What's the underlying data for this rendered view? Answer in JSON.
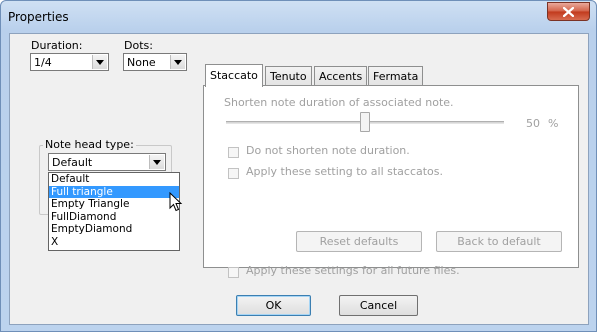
{
  "window": {
    "title": "Properties"
  },
  "duration": {
    "label": "Duration:",
    "value": "1/4"
  },
  "dots": {
    "label": "Dots:",
    "value": "None"
  },
  "notehead": {
    "group_label": "Note head type:",
    "value": "Default",
    "options": [
      "Default",
      "Full triangle",
      "Empty Triangle",
      "FullDiamond",
      "EmptyDiamond",
      "X"
    ],
    "highlighted_index": 1
  },
  "tabs": [
    {
      "label": "Staccato",
      "active": true
    },
    {
      "label": "Tenuto",
      "active": false
    },
    {
      "label": "Accents",
      "active": false
    },
    {
      "label": "Fermata",
      "active": false
    }
  ],
  "staccato": {
    "description": "Shorten note duration of associated note.",
    "slider_value": 50,
    "slider_value_text": "50",
    "slider_unit": "%",
    "check_no_shorten": "Do not shorten note duration.",
    "check_apply_all": "Apply these setting to all staccatos.",
    "reset_defaults": "Reset defaults",
    "back_to_default": "Back to default",
    "check_future_files": "Apply these settings for all future files."
  },
  "buttons": {
    "ok": "OK",
    "cancel": "Cancel"
  }
}
